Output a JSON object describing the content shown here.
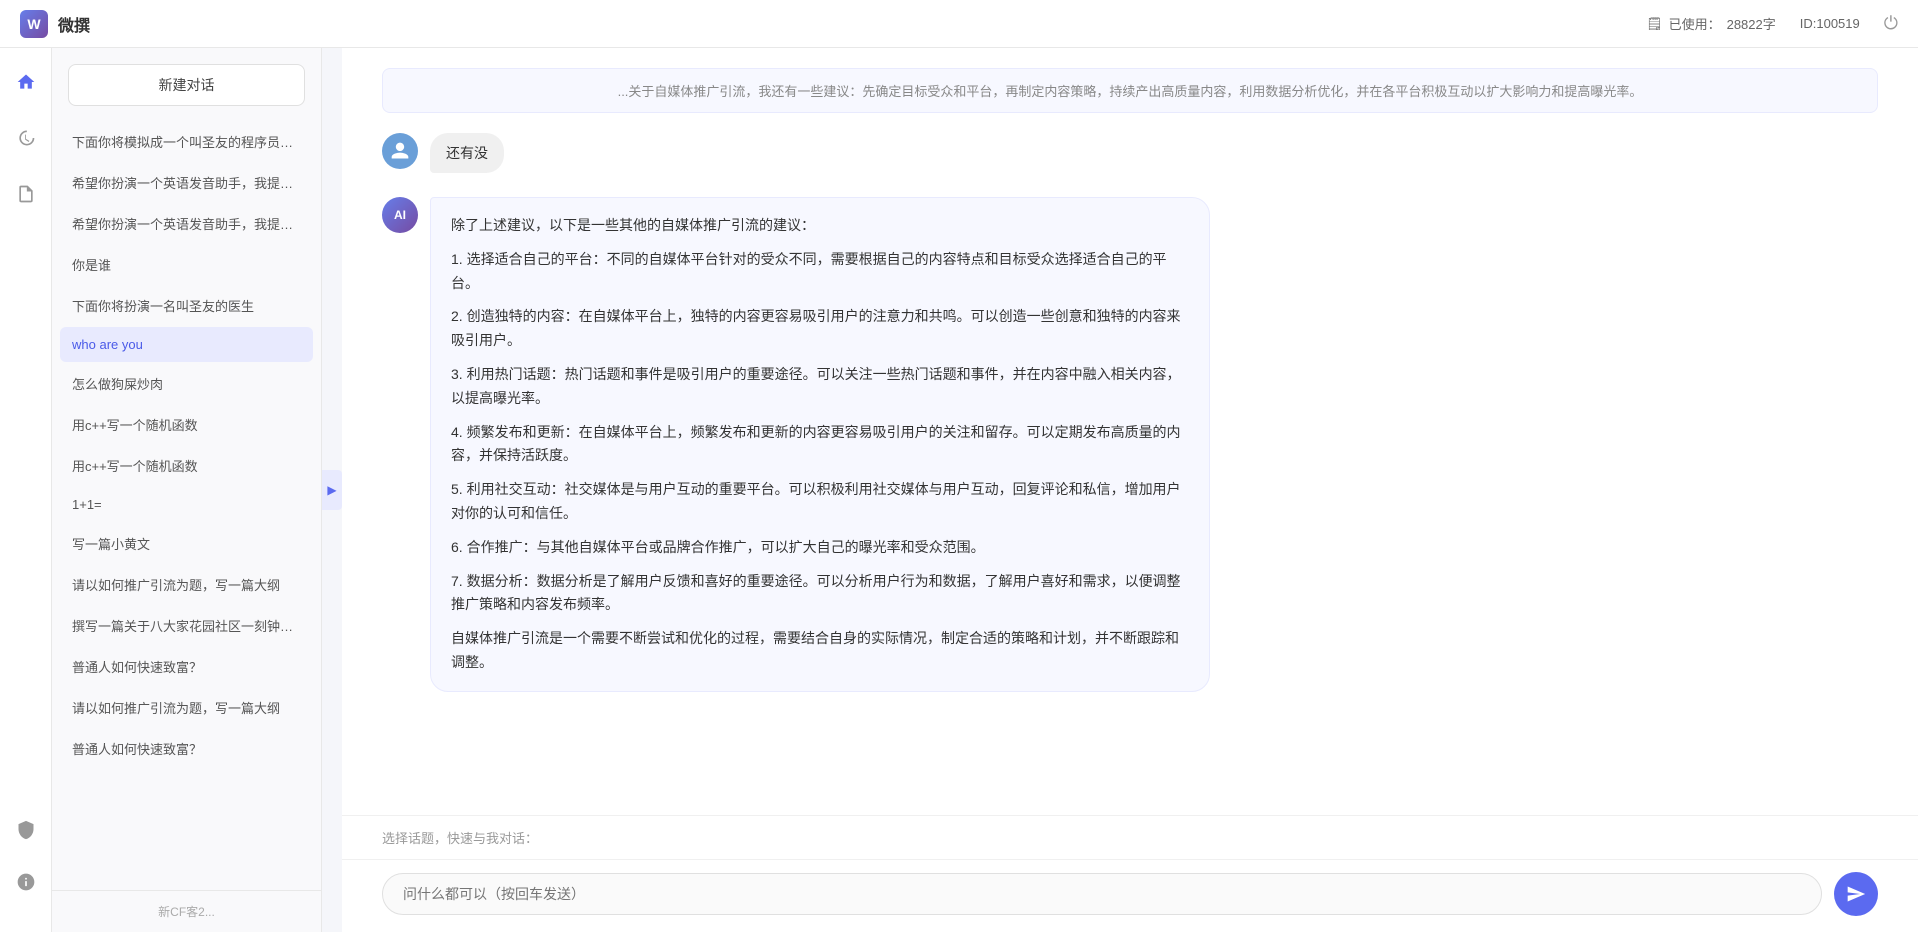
{
  "header": {
    "title": "微撰",
    "logo_letter": "W",
    "usage_label": "已使用：",
    "usage_count": "28822字",
    "id_label": "ID:100519"
  },
  "sidebar": {
    "new_btn_label": "新建对话",
    "items": [
      {
        "id": 1,
        "label": "下面你将模拟成一个叫圣友的程序员，我说..."
      },
      {
        "id": 2,
        "label": "希望你扮演一个英语发音助手，我提供给你..."
      },
      {
        "id": 3,
        "label": "希望你扮演一个英语发音助手，我提供给你..."
      },
      {
        "id": 4,
        "label": "你是谁"
      },
      {
        "id": 5,
        "label": "下面你将扮演一名叫圣友的医生"
      },
      {
        "id": 6,
        "label": "who are you",
        "active": true
      },
      {
        "id": 7,
        "label": "怎么做狗屎炒肉"
      },
      {
        "id": 8,
        "label": "用c++写一个随机函数"
      },
      {
        "id": 9,
        "label": "用c++写一个随机函数"
      },
      {
        "id": 10,
        "label": "1+1="
      },
      {
        "id": 11,
        "label": "写一篇小黄文"
      },
      {
        "id": 12,
        "label": "请以如何推广引流为题，写一篇大纲"
      },
      {
        "id": 13,
        "label": "撰写一篇关于八大家花园社区一刻钟便民生..."
      },
      {
        "id": 14,
        "label": "普通人如何快速致富？"
      },
      {
        "id": 15,
        "label": "请以如何推广引流为题，写一篇大纲"
      },
      {
        "id": 16,
        "label": "普通人如何快速致富？"
      }
    ],
    "bottom_text": "新CF客2..."
  },
  "chat": {
    "truncated_message": "...关于自媒体推广引流，我还有一些建议：先确定目标受众和平台，再制定内容策略，持续产出高质量内容，利用数据分析优化，并在各平台积极互动以扩大影响力和提高曝光率。",
    "messages": [
      {
        "type": "user",
        "text": "还有没"
      },
      {
        "type": "ai",
        "paragraphs": [
          "除了上述建议，以下是一些其他的自媒体推广引流的建议：",
          "1. 选择适合自己的平台：不同的自媒体平台针对的受众不同，需要根据自己的内容特点和目标受众选择适合自己的平台。",
          "2. 创造独特的内容：在自媒体平台上，独特的内容更容易吸引用户的注意力和共鸣。可以创造一些创意和独特的内容来吸引用户。",
          "3. 利用热门话题：热门话题和事件是吸引用户的重要途径。可以关注一些热门话题和事件，并在内容中融入相关内容，以提高曝光率。",
          "4. 频繁发布和更新：在自媒体平台上，频繁发布和更新的内容更容易吸引用户的关注和留存。可以定期发布高质量的内容，并保持活跃度。",
          "5. 利用社交互动：社交媒体是与用户互动的重要平台。可以积极利用社交媒体与用户互动，回复评论和私信，增加用户对你的认可和信任。",
          "6. 合作推广：与其他自媒体平台或品牌合作推广，可以扩大自己的曝光率和受众范围。",
          "7. 数据分析：数据分析是了解用户反馈和喜好的重要途径。可以分析用户行为和数据，了解用户喜好和需求，以便调整推广策略和内容发布频率。",
          "自媒体推广引流是一个需要不断尝试和优化的过程，需要结合自身的实际情况，制定合适的策略和计划，并不断跟踪和调整。"
        ]
      }
    ],
    "quick_prompts_label": "选择话题，快速与我对话：",
    "input_placeholder": "问什么都可以（按回车发送）"
  },
  "icons": {
    "logo": "W",
    "usage_icon": "📋",
    "power_icon": "⏻",
    "home_icon": "⌂",
    "clock_icon": "🕐",
    "doc_icon": "📄",
    "arrow_right": "▶",
    "shield_icon": "🛡",
    "info_icon": "ℹ",
    "send_icon": "➤"
  },
  "colors": {
    "accent": "#5b6af0",
    "sidebar_active": "#e8eafe",
    "ai_bg": "#f7f8ff",
    "ai_border": "#e8eafe"
  }
}
